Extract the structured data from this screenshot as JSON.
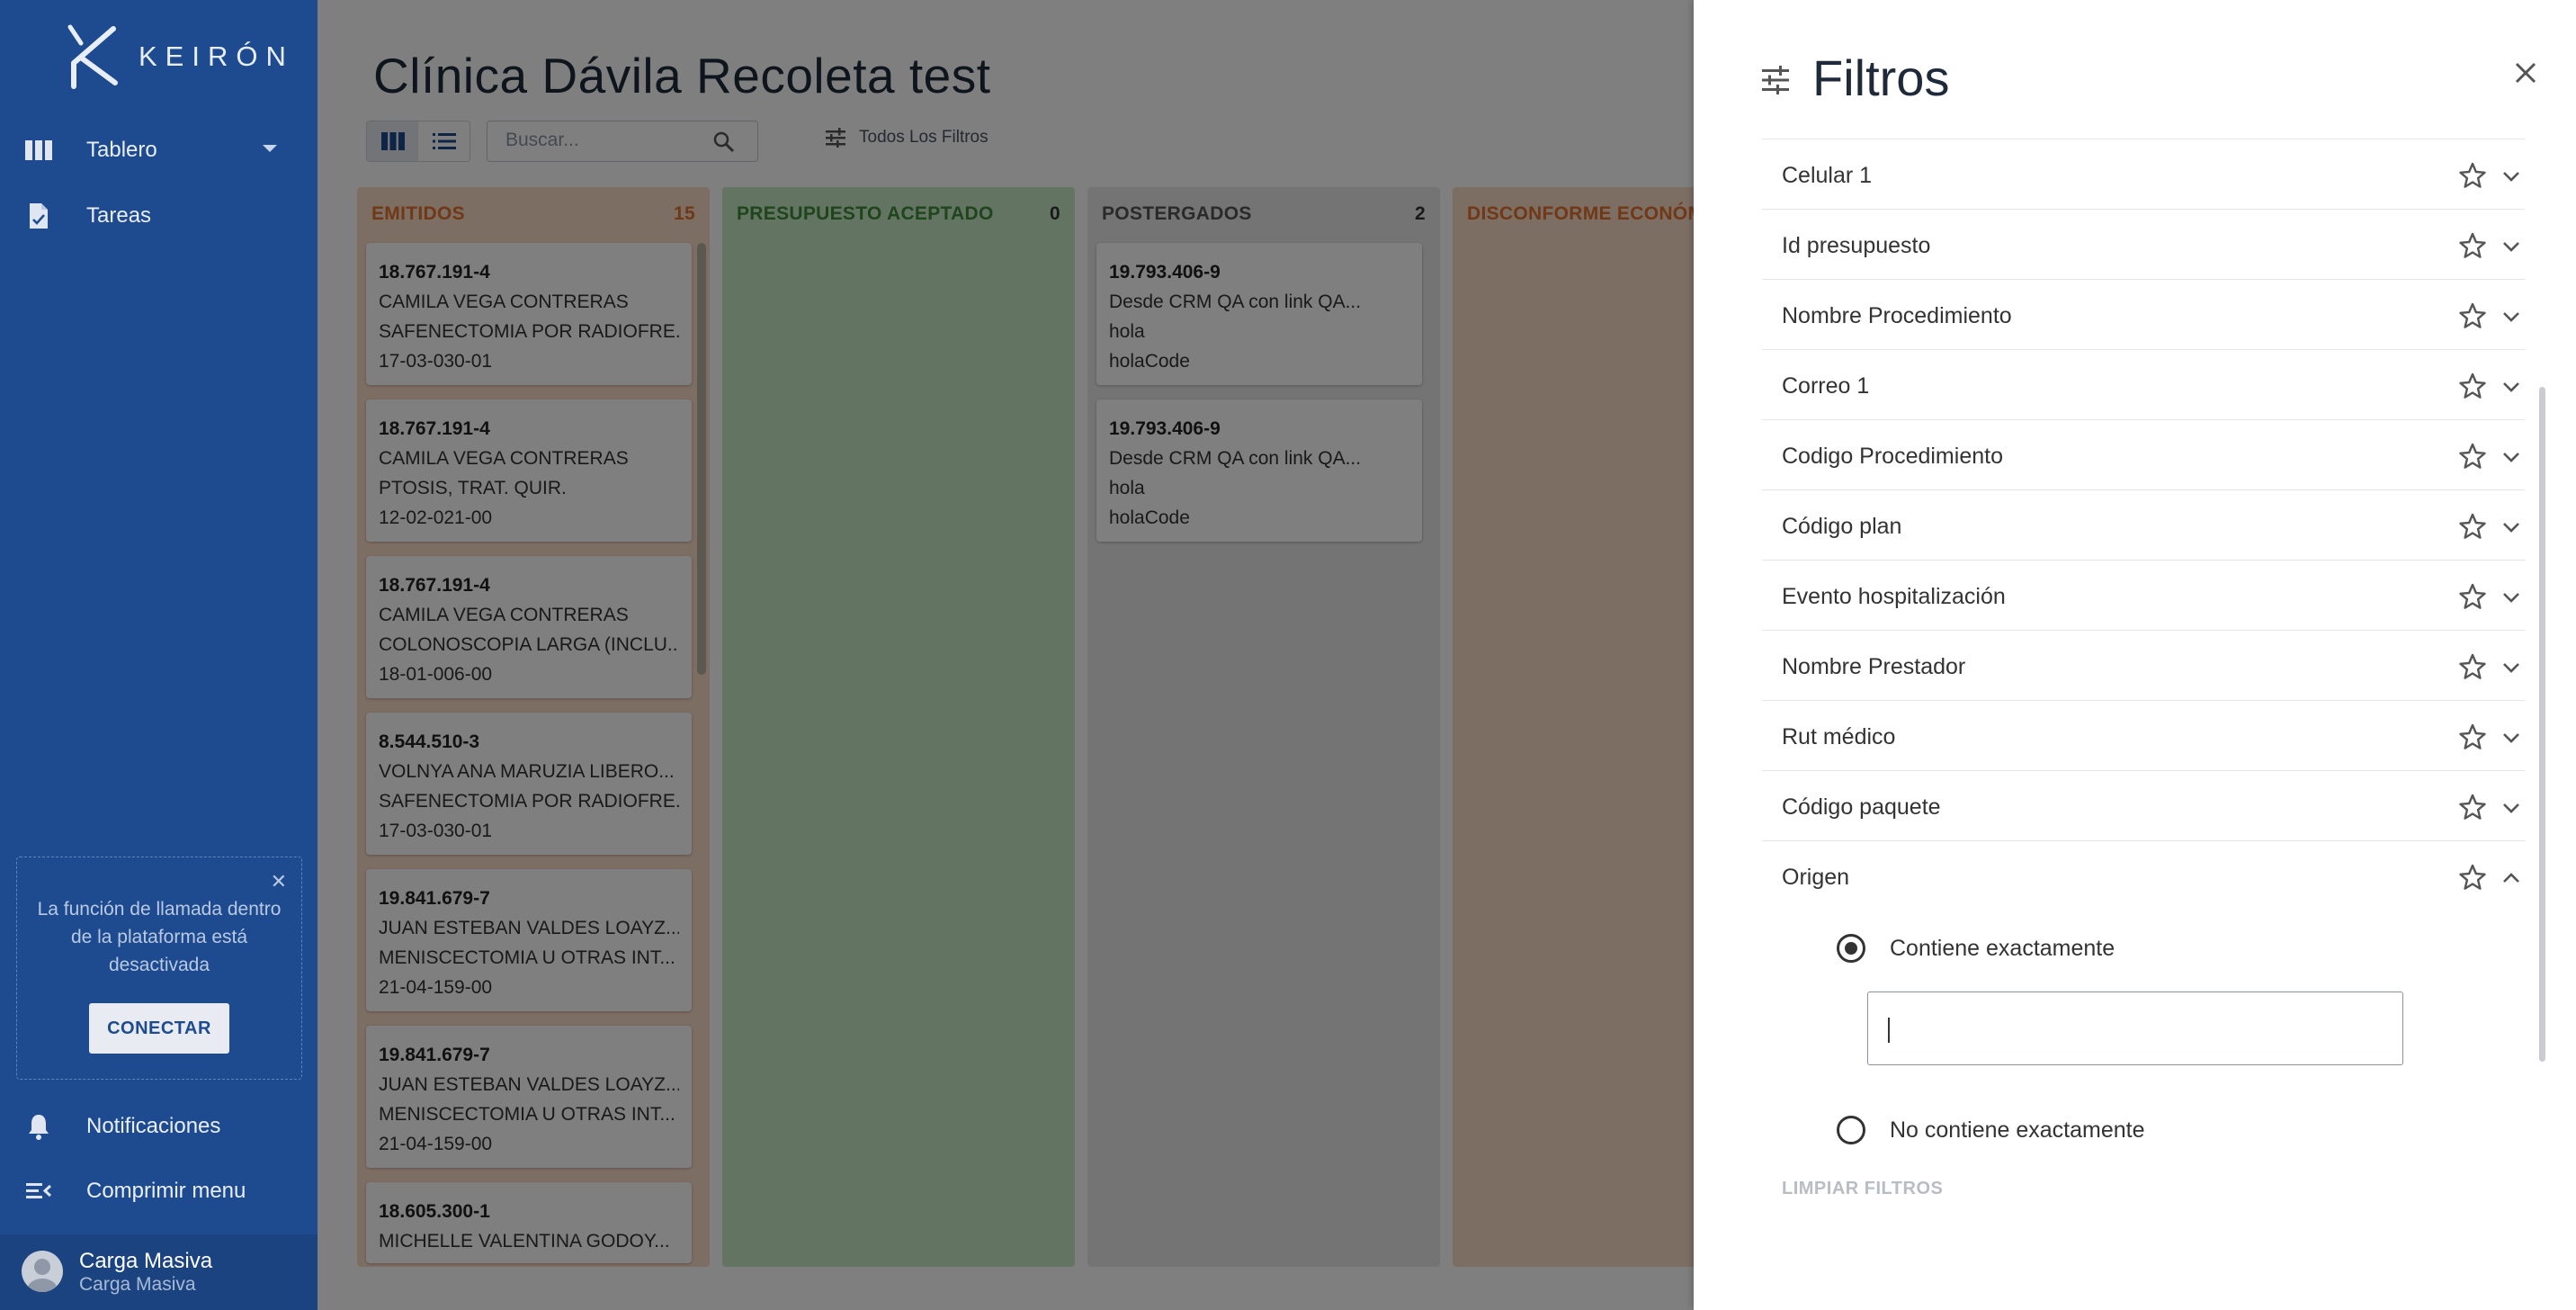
{
  "brand": {
    "logo_text": "KEIRÓN"
  },
  "sidebar": {
    "items": [
      {
        "label": "Tablero",
        "icon": "columns-icon"
      },
      {
        "label": "Tareas",
        "icon": "document-icon"
      },
      {
        "label": "Notificaciones",
        "icon": "bell-icon"
      },
      {
        "label": "Comprimir menu",
        "icon": "collapse-menu-icon"
      }
    ],
    "call_notice": {
      "message": "La función de llamada dentro de la plataforma está desactivada",
      "button": "CONECTAR"
    },
    "user": {
      "name": "Carga Masiva",
      "subtitle": "Carga Masiva"
    }
  },
  "header": {
    "title": "Clínica Dávila Recoleta test",
    "search_placeholder": "Buscar...",
    "all_filters_label": "Todos Los Filtros"
  },
  "board": {
    "columns": [
      {
        "title": "EMITIDOS",
        "count": "15",
        "color": "#e0702e",
        "bg": "#fbdcc8"
      },
      {
        "title": "PRESUPUESTO ACEPTADO",
        "count": "0",
        "color": "#3f8a3a",
        "bg": "#c9e8c4"
      },
      {
        "title": "POSTERGADOS",
        "count": "2",
        "color": "#555555",
        "bg": "#e9e9e9"
      },
      {
        "title": "DISCONFORME ECONÓMIC",
        "count": "",
        "color": "#e0702e",
        "bg": "#fbdcc8"
      }
    ],
    "emitidos_cards": [
      {
        "rut": "18.767.191-4",
        "name": "CAMILA VEGA CONTRERAS",
        "proc": "SAFENECTOMIA POR RADIOFRE...",
        "code": "17-03-030-01"
      },
      {
        "rut": "18.767.191-4",
        "name": "CAMILA VEGA CONTRERAS",
        "proc": "PTOSIS, TRAT. QUIR.",
        "code": "12-02-021-00"
      },
      {
        "rut": "18.767.191-4",
        "name": "CAMILA VEGA CONTRERAS",
        "proc": "COLONOSCOPIA LARGA (INCLU...",
        "code": "18-01-006-00"
      },
      {
        "rut": "8.544.510-3",
        "name": "VOLNYA ANA MARUZIA LIBERO...",
        "proc": "SAFENECTOMIA POR RADIOFRE...",
        "code": "17-03-030-01"
      },
      {
        "rut": "19.841.679-7",
        "name": "JUAN ESTEBAN VALDES LOAYZ...",
        "proc": "MENISCECTOMIA U OTRAS INT...",
        "code": "21-04-159-00"
      },
      {
        "rut": "19.841.679-7",
        "name": "JUAN ESTEBAN VALDES LOAYZ...",
        "proc": "MENISCECTOMIA U OTRAS INT...",
        "code": "21-04-159-00"
      },
      {
        "rut": "18.605.300-1",
        "name": "MICHELLE VALENTINA GODOY...",
        "proc": "",
        "code": ""
      }
    ],
    "postergados_cards": [
      {
        "rut": "19.793.406-9",
        "name": "Desde CRM QA con link QA...",
        "proc": "hola",
        "code": "holaCode"
      },
      {
        "rut": "19.793.406-9",
        "name": "Desde CRM QA con link QA...",
        "proc": "hola",
        "code": "holaCode"
      }
    ]
  },
  "filters_panel": {
    "title": "Filtros",
    "rows": [
      "Celular 1",
      "Id presupuesto",
      "Nombre Procedimiento",
      "Correo 1",
      "Codigo Procedimiento",
      "Código plan",
      "Evento hospitalización",
      "Nombre Prestador",
      "Rut médico",
      "Código paquete",
      "Origen"
    ],
    "expanded": "Origen",
    "options": [
      {
        "label": "Contiene exactamente",
        "selected": true
      },
      {
        "label": "No contiene exactamente",
        "selected": false
      }
    ],
    "input_value": "",
    "clear_label": "LIMPIAR FILTROS"
  }
}
